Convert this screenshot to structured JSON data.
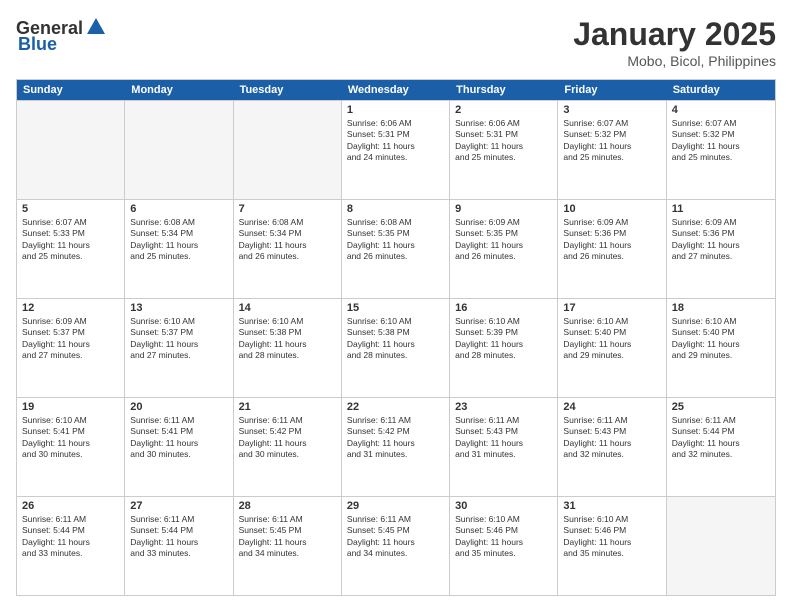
{
  "header": {
    "logo_general": "General",
    "logo_blue": "Blue",
    "month": "January 2025",
    "location": "Mobo, Bicol, Philippines"
  },
  "days_of_week": [
    "Sunday",
    "Monday",
    "Tuesday",
    "Wednesday",
    "Thursday",
    "Friday",
    "Saturday"
  ],
  "rows": [
    [
      {
        "day": "",
        "empty": true,
        "text": ""
      },
      {
        "day": "",
        "empty": true,
        "text": ""
      },
      {
        "day": "",
        "empty": true,
        "text": ""
      },
      {
        "day": "1",
        "empty": false,
        "text": "Sunrise: 6:06 AM\nSunset: 5:31 PM\nDaylight: 11 hours\nand 24 minutes."
      },
      {
        "day": "2",
        "empty": false,
        "text": "Sunrise: 6:06 AM\nSunset: 5:31 PM\nDaylight: 11 hours\nand 25 minutes."
      },
      {
        "day": "3",
        "empty": false,
        "text": "Sunrise: 6:07 AM\nSunset: 5:32 PM\nDaylight: 11 hours\nand 25 minutes."
      },
      {
        "day": "4",
        "empty": false,
        "text": "Sunrise: 6:07 AM\nSunset: 5:32 PM\nDaylight: 11 hours\nand 25 minutes."
      }
    ],
    [
      {
        "day": "5",
        "empty": false,
        "text": "Sunrise: 6:07 AM\nSunset: 5:33 PM\nDaylight: 11 hours\nand 25 minutes."
      },
      {
        "day": "6",
        "empty": false,
        "text": "Sunrise: 6:08 AM\nSunset: 5:34 PM\nDaylight: 11 hours\nand 25 minutes."
      },
      {
        "day": "7",
        "empty": false,
        "text": "Sunrise: 6:08 AM\nSunset: 5:34 PM\nDaylight: 11 hours\nand 26 minutes."
      },
      {
        "day": "8",
        "empty": false,
        "text": "Sunrise: 6:08 AM\nSunset: 5:35 PM\nDaylight: 11 hours\nand 26 minutes."
      },
      {
        "day": "9",
        "empty": false,
        "text": "Sunrise: 6:09 AM\nSunset: 5:35 PM\nDaylight: 11 hours\nand 26 minutes."
      },
      {
        "day": "10",
        "empty": false,
        "text": "Sunrise: 6:09 AM\nSunset: 5:36 PM\nDaylight: 11 hours\nand 26 minutes."
      },
      {
        "day": "11",
        "empty": false,
        "text": "Sunrise: 6:09 AM\nSunset: 5:36 PM\nDaylight: 11 hours\nand 27 minutes."
      }
    ],
    [
      {
        "day": "12",
        "empty": false,
        "text": "Sunrise: 6:09 AM\nSunset: 5:37 PM\nDaylight: 11 hours\nand 27 minutes."
      },
      {
        "day": "13",
        "empty": false,
        "text": "Sunrise: 6:10 AM\nSunset: 5:37 PM\nDaylight: 11 hours\nand 27 minutes."
      },
      {
        "day": "14",
        "empty": false,
        "text": "Sunrise: 6:10 AM\nSunset: 5:38 PM\nDaylight: 11 hours\nand 28 minutes."
      },
      {
        "day": "15",
        "empty": false,
        "text": "Sunrise: 6:10 AM\nSunset: 5:38 PM\nDaylight: 11 hours\nand 28 minutes."
      },
      {
        "day": "16",
        "empty": false,
        "text": "Sunrise: 6:10 AM\nSunset: 5:39 PM\nDaylight: 11 hours\nand 28 minutes."
      },
      {
        "day": "17",
        "empty": false,
        "text": "Sunrise: 6:10 AM\nSunset: 5:40 PM\nDaylight: 11 hours\nand 29 minutes."
      },
      {
        "day": "18",
        "empty": false,
        "text": "Sunrise: 6:10 AM\nSunset: 5:40 PM\nDaylight: 11 hours\nand 29 minutes."
      }
    ],
    [
      {
        "day": "19",
        "empty": false,
        "text": "Sunrise: 6:10 AM\nSunset: 5:41 PM\nDaylight: 11 hours\nand 30 minutes."
      },
      {
        "day": "20",
        "empty": false,
        "text": "Sunrise: 6:11 AM\nSunset: 5:41 PM\nDaylight: 11 hours\nand 30 minutes."
      },
      {
        "day": "21",
        "empty": false,
        "text": "Sunrise: 6:11 AM\nSunset: 5:42 PM\nDaylight: 11 hours\nand 30 minutes."
      },
      {
        "day": "22",
        "empty": false,
        "text": "Sunrise: 6:11 AM\nSunset: 5:42 PM\nDaylight: 11 hours\nand 31 minutes."
      },
      {
        "day": "23",
        "empty": false,
        "text": "Sunrise: 6:11 AM\nSunset: 5:43 PM\nDaylight: 11 hours\nand 31 minutes."
      },
      {
        "day": "24",
        "empty": false,
        "text": "Sunrise: 6:11 AM\nSunset: 5:43 PM\nDaylight: 11 hours\nand 32 minutes."
      },
      {
        "day": "25",
        "empty": false,
        "text": "Sunrise: 6:11 AM\nSunset: 5:44 PM\nDaylight: 11 hours\nand 32 minutes."
      }
    ],
    [
      {
        "day": "26",
        "empty": false,
        "text": "Sunrise: 6:11 AM\nSunset: 5:44 PM\nDaylight: 11 hours\nand 33 minutes."
      },
      {
        "day": "27",
        "empty": false,
        "text": "Sunrise: 6:11 AM\nSunset: 5:44 PM\nDaylight: 11 hours\nand 33 minutes."
      },
      {
        "day": "28",
        "empty": false,
        "text": "Sunrise: 6:11 AM\nSunset: 5:45 PM\nDaylight: 11 hours\nand 34 minutes."
      },
      {
        "day": "29",
        "empty": false,
        "text": "Sunrise: 6:11 AM\nSunset: 5:45 PM\nDaylight: 11 hours\nand 34 minutes."
      },
      {
        "day": "30",
        "empty": false,
        "text": "Sunrise: 6:10 AM\nSunset: 5:46 PM\nDaylight: 11 hours\nand 35 minutes."
      },
      {
        "day": "31",
        "empty": false,
        "text": "Sunrise: 6:10 AM\nSunset: 5:46 PM\nDaylight: 11 hours\nand 35 minutes."
      },
      {
        "day": "",
        "empty": true,
        "text": ""
      }
    ]
  ]
}
